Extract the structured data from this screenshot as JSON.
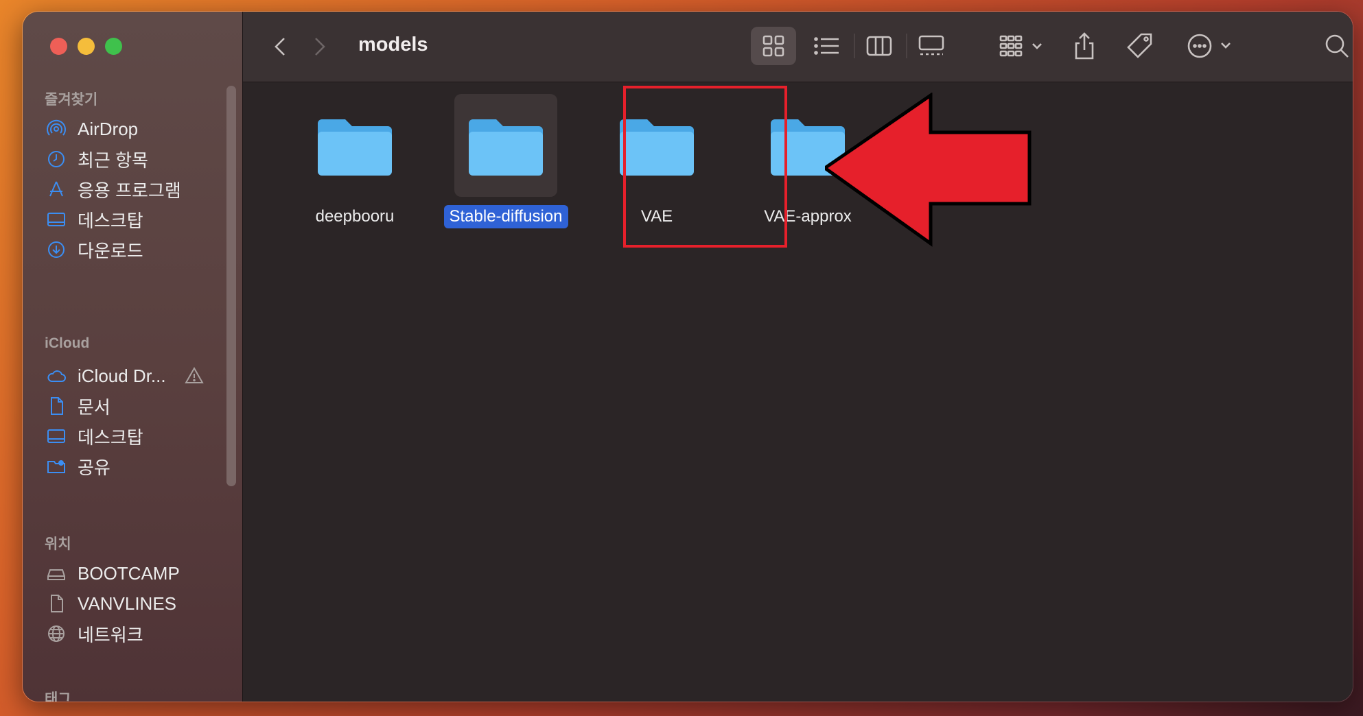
{
  "window": {
    "title": "models"
  },
  "sidebar": {
    "sections": {
      "favorites": "즐겨찾기",
      "icloud": "iCloud",
      "locations": "위치",
      "tags": "태그"
    },
    "favorites": [
      {
        "label": "AirDrop",
        "icon": "airdrop-icon"
      },
      {
        "label": "최근 항목",
        "icon": "clock-icon"
      },
      {
        "label": "응용 프로그램",
        "icon": "applications-icon"
      },
      {
        "label": "데스크탑",
        "icon": "desktop-icon"
      },
      {
        "label": "다운로드",
        "icon": "download-icon"
      }
    ],
    "icloud": [
      {
        "label": "iCloud Dr...",
        "icon": "cloud-icon"
      },
      {
        "label": "문서",
        "icon": "document-icon"
      },
      {
        "label": "데스크탑",
        "icon": "desktop-icon"
      },
      {
        "label": "공유",
        "icon": "shared-folder-icon"
      }
    ],
    "locations": [
      {
        "label": "BOOTCAMP",
        "icon": "drive-icon"
      },
      {
        "label": "VANVLINES",
        "icon": "document-icon"
      },
      {
        "label": "네트워크",
        "icon": "globe-icon"
      }
    ]
  },
  "files": [
    {
      "name": "deepbooru",
      "selected": false
    },
    {
      "name": "Stable-diffusion",
      "selected": true
    },
    {
      "name": "VAE",
      "selected": false
    },
    {
      "name": "VAE-approx",
      "selected": false
    }
  ],
  "colors": {
    "accent": "#2f62d6",
    "folder": "#6cc3f7",
    "annotation": "#e6202b"
  }
}
